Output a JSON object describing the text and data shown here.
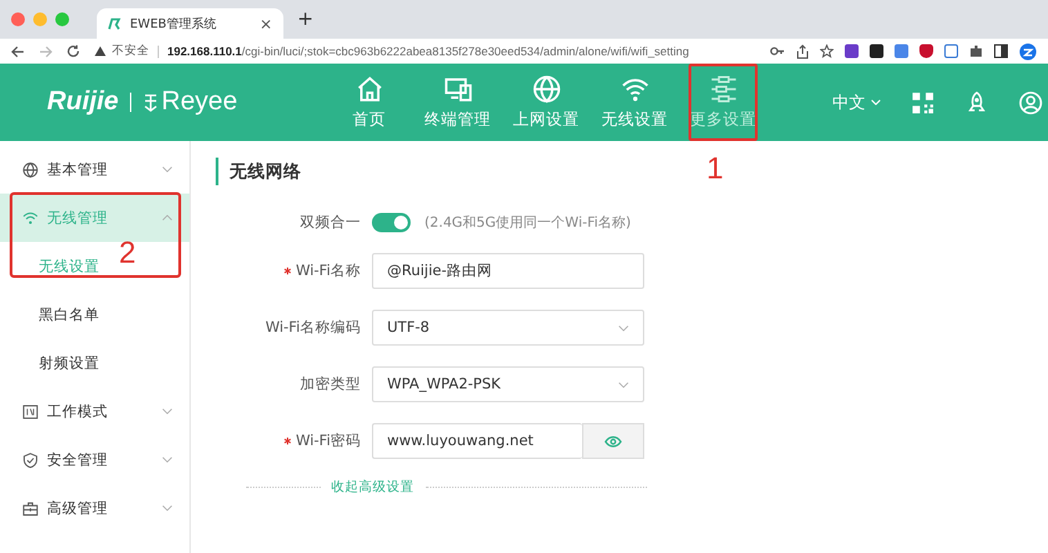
{
  "browser": {
    "tab_title": "EWEB管理系统",
    "tab_close": "×",
    "new_tab": "+",
    "security": "不安全",
    "url_host": "192.168.110.1",
    "url_path": "/cgi-bin/luci/;stok=cbc963b6222abea8135f278e30eed534/admin/alone/wifi/wifi_setting"
  },
  "header": {
    "logo": "Ruijie",
    "sub_logo": "Reyee",
    "language": "中文",
    "nav": [
      {
        "label": "首页",
        "selected": false
      },
      {
        "label": "终端管理",
        "selected": false
      },
      {
        "label": "上网设置",
        "selected": false
      },
      {
        "label": "无线设置",
        "selected": false
      },
      {
        "label": "更多设置",
        "selected": true
      }
    ]
  },
  "sidebar": {
    "items": [
      {
        "label": "基本管理",
        "expanded": false,
        "selected": false
      },
      {
        "label": "无线管理",
        "expanded": true,
        "selected": true,
        "children": [
          {
            "label": "无线设置",
            "selected": true
          },
          {
            "label": "黑白名单",
            "selected": false
          },
          {
            "label": "射频设置",
            "selected": false
          }
        ]
      },
      {
        "label": "工作模式",
        "expanded": false,
        "selected": false
      },
      {
        "label": "安全管理",
        "expanded": false,
        "selected": false
      },
      {
        "label": "高级管理",
        "expanded": false,
        "selected": false
      }
    ]
  },
  "content": {
    "title": "无线网络",
    "fields": [
      {
        "kind": "toggle",
        "label": "双频合一",
        "on": true,
        "hint": "(2.4G和5G使用同一个Wi-Fi名称)",
        "required": false
      },
      {
        "kind": "text",
        "label": "Wi-Fi名称",
        "value": "@Ruijie-路由网",
        "required": true
      },
      {
        "kind": "select",
        "label": "Wi-Fi名称编码",
        "value": "UTF-8",
        "required": false
      },
      {
        "kind": "select",
        "label": "加密类型",
        "value": "WPA_WPA2-PSK",
        "required": false
      },
      {
        "kind": "password",
        "label": "Wi-Fi密码",
        "value": "www.luyouwang.net",
        "required": true
      }
    ],
    "advanced_link": "收起高级设置"
  },
  "annotations": [
    {
      "text": "1"
    },
    {
      "text": "2"
    }
  ]
}
